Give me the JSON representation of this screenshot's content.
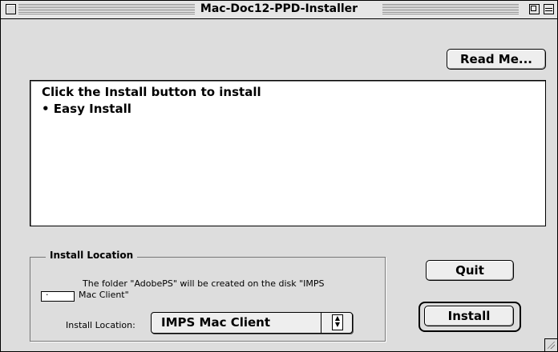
{
  "window": {
    "title": "Mac-Doc12-PPD-Installer"
  },
  "buttons": {
    "readme": "Read Me...",
    "quit": "Quit",
    "install": "Install"
  },
  "main_text": {
    "line1": "Click the Install button to install",
    "line2": "• Easy Install"
  },
  "install_location": {
    "group_title": "Install Location",
    "desc_line1": "The folder \"AdobePS\" will be created on the disk \"IMPS",
    "desc_line2": "Mac Client\"",
    "label": "Install Location:",
    "selected": "IMPS Mac Client"
  },
  "icons": {
    "close": "close-box",
    "zoom": "zoom-box",
    "collapse": "collapse-box",
    "popup_arrow": "up-down-arrows-icon",
    "grow": "grow-box"
  }
}
